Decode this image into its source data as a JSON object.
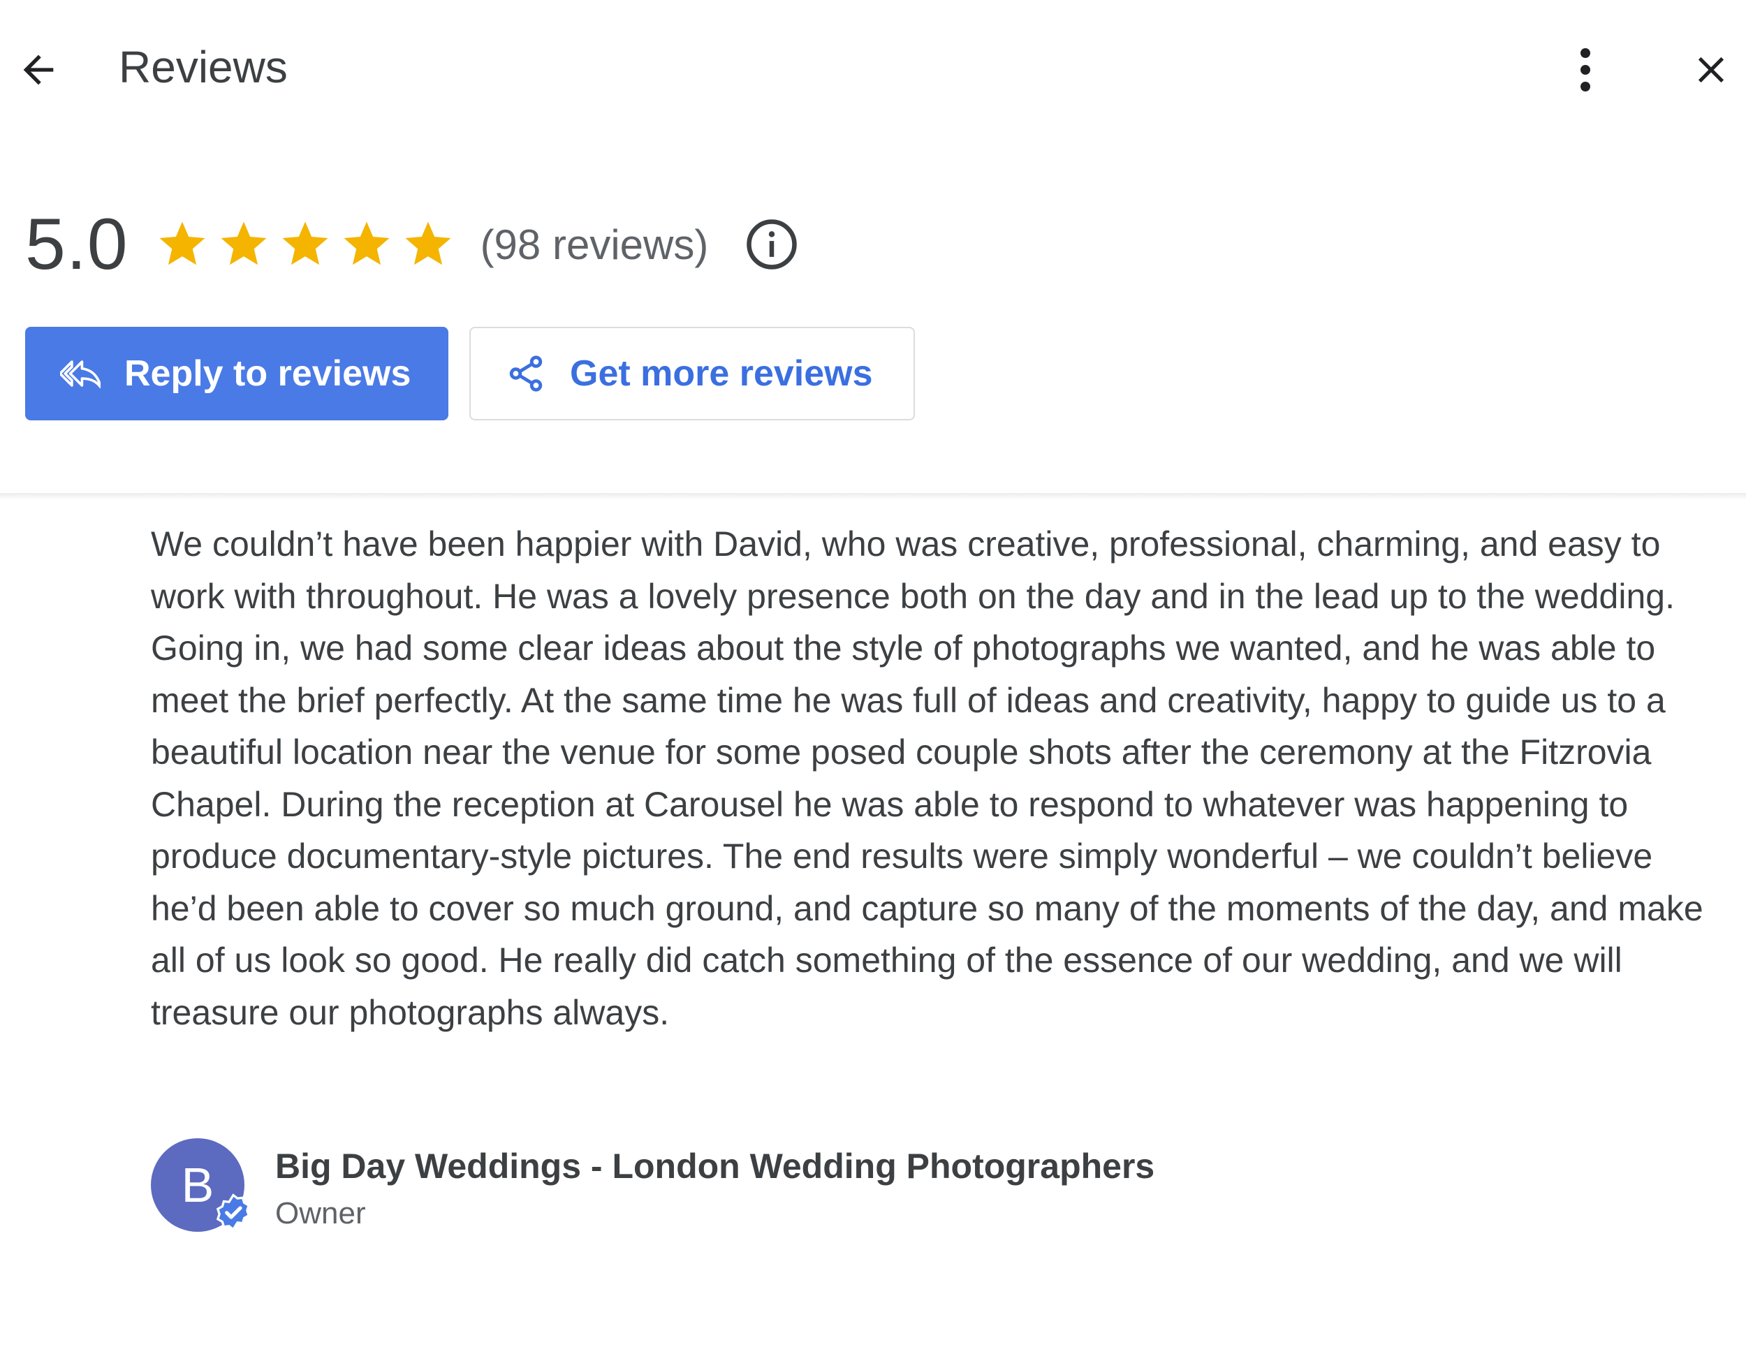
{
  "header": {
    "title": "Reviews"
  },
  "summary": {
    "rating": "5.0",
    "stars": 5,
    "star_color": "#f4b400",
    "review_count": "(98 reviews)"
  },
  "actions": {
    "reply_label": "Reply to reviews",
    "get_more_label": "Get more reviews",
    "primary_color": "#4a7ae6"
  },
  "review": {
    "text": "We couldn’t have been happier with David, who was creative, professional, charming, and easy to work with throughout. He was a lovely presence both on the day and in the lead up to the wedding. Going in, we had some clear ideas about the style of photographs we wanted, and he was able to meet the brief perfectly. At the same time he was full of ideas and creativity, happy to guide us to a beautiful location near the venue for some posed couple shots after the ceremony at the Fitzrovia Chapel. During the reception at Carousel he was able to respond to whatever was happening to produce documentary-style pictures. The end results were simply wonderful – we couldn’t believe he’d been able to cover so much ground, and capture so many of the moments of the day, and make all of us look so good. He really did catch something of the essence of our wedding, and we will treasure our photographs always."
  },
  "owner": {
    "avatar_letter": "B",
    "avatar_color": "#5c6bc0",
    "name": "Big Day Weddings - London Wedding Photographers",
    "role": "Owner"
  },
  "icons": {
    "back": "arrow-back-icon",
    "more": "more-vert-icon",
    "close": "close-icon",
    "info": "info-icon",
    "reply": "reply-all-icon",
    "share": "share-icon",
    "verified": "verified-badge-icon"
  }
}
